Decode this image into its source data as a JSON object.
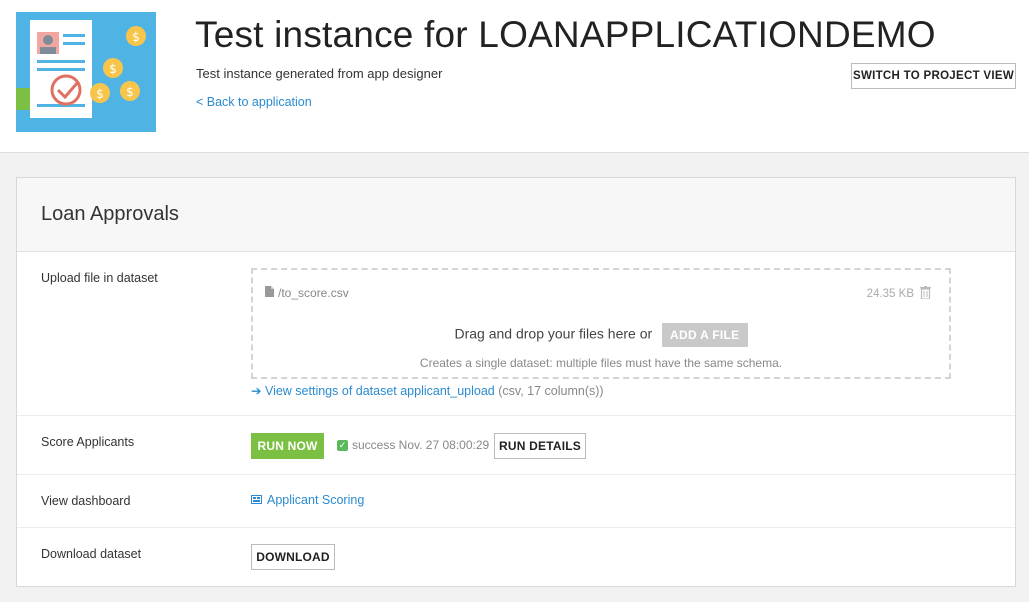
{
  "header": {
    "title": "Test instance for LOANAPPLICATIONDEMO",
    "subtitle": "Test instance generated from app designer",
    "back_link": "< Back to application",
    "switch_button": "SWITCH TO PROJECT VIEW"
  },
  "card": {
    "title": "Loan Approvals",
    "upload": {
      "label": "Upload file in dataset",
      "file_name": "/to_score.csv",
      "file_size": "24.35 KB",
      "drop_text": "Drag and drop your files here or",
      "add_file": "ADD A FILE",
      "hint": "Creates a single dataset: multiple files must have the same schema.",
      "settings_link": "View settings of dataset applicant_upload",
      "settings_meta": " (csv, 17 column(s))"
    },
    "score": {
      "label": "Score Applicants",
      "run_now": "RUN NOW",
      "status": "success Nov. 27 08:00:29",
      "run_details": "RUN DETAILS"
    },
    "dashboard": {
      "label": "View dashboard",
      "link": "Applicant Scoring"
    },
    "download": {
      "label": "Download dataset",
      "button": "DOWNLOAD"
    }
  },
  "colors": {
    "accent": "#2a8bd0",
    "run_green": "#7cc043",
    "icon_bg": "#4fb3e4"
  }
}
